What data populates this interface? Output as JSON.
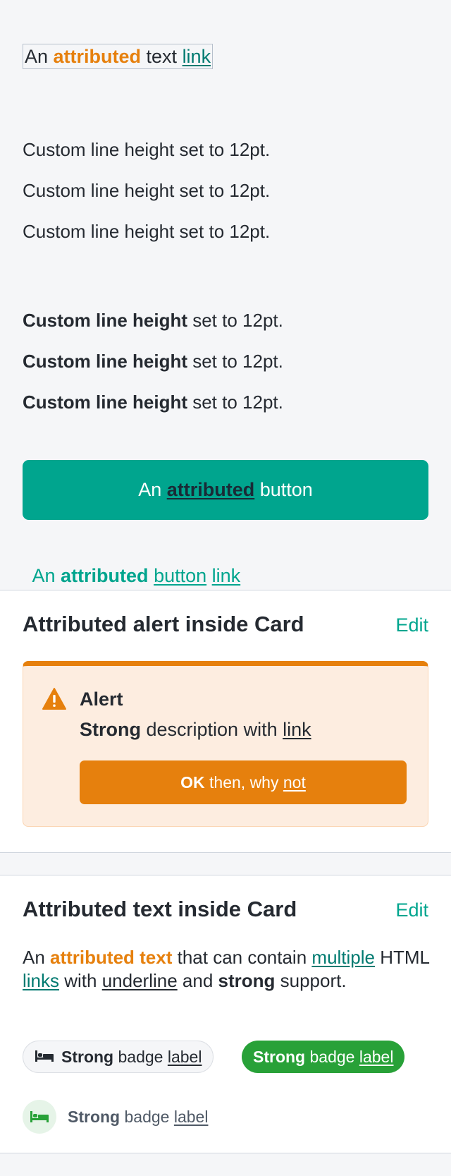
{
  "attributed_text_link": {
    "part1": "An ",
    "part2": "attributed",
    "part3": " text ",
    "part4": "link"
  },
  "line_height_group_1": [
    {
      "text": "Custom line height set to 12pt."
    },
    {
      "text": "Custom line height set to 12pt."
    },
    {
      "text": "Custom line height set to 12pt."
    }
  ],
  "line_height_group_2": [
    {
      "bold": "Custom line height",
      "rest": " set to 12pt."
    },
    {
      "bold": "Custom line height",
      "rest": " set to 12pt."
    },
    {
      "bold": "Custom line height",
      "rest": " set to 12pt."
    }
  ],
  "primary_button": {
    "part1": "An ",
    "part2": "attributed",
    "part3": " button"
  },
  "button_link": {
    "part1": "An ",
    "part2": "attributed",
    "part3": " ",
    "part4": "button",
    "part5": " ",
    "part6": "link"
  },
  "alert_card": {
    "title": "Attributed alert inside Card",
    "edit": "Edit",
    "alert": {
      "title": "Alert",
      "desc_strong": "Strong",
      "desc_mid": " description with ",
      "desc_link": "link",
      "button_strong": "OK",
      "button_mid": " then, why ",
      "button_link": "not"
    }
  },
  "text_card": {
    "title": "Attributed text inside Card",
    "edit": "Edit",
    "text": {
      "p1": "An ",
      "p2": "attributed text",
      "p3": " that can contain ",
      "p4": "multiple",
      "p5": " HTML ",
      "p6": "links",
      "p7": " with ",
      "p8": "underline",
      "p9": " and ",
      "p10": "strong",
      "p11": " support."
    },
    "badges": {
      "strong": "Strong",
      "mid": " badge ",
      "label": "label"
    }
  },
  "colors": {
    "teal": "#00a58e",
    "orange": "#e6800d",
    "green": "#28a138"
  }
}
